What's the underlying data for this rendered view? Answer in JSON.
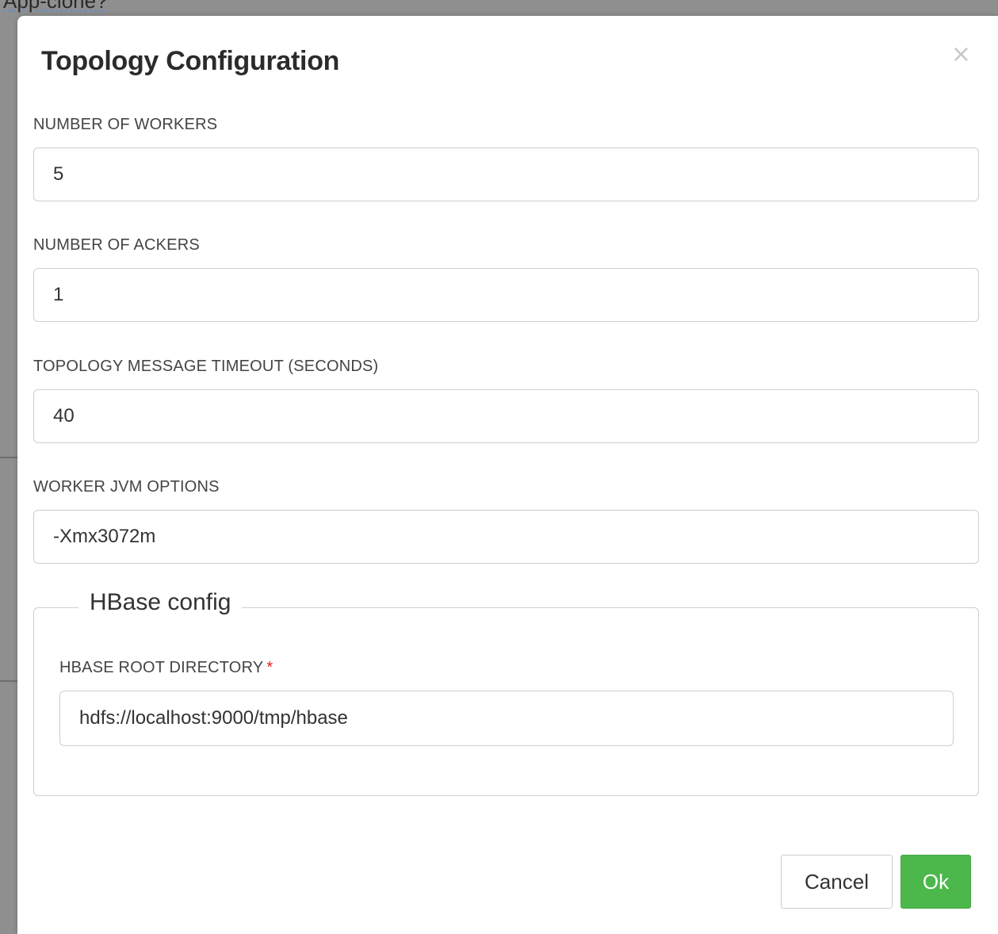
{
  "backdrop": {
    "partial_text": "App-clone?"
  },
  "modal": {
    "title": "Topology Configuration",
    "close_symbol": "×"
  },
  "fields": {
    "workers": {
      "label": "NUMBER OF WORKERS",
      "value": "5"
    },
    "ackers": {
      "label": "NUMBER OF ACKERS",
      "value": "1"
    },
    "timeout": {
      "label": "TOPOLOGY MESSAGE TIMEOUT (SECONDS)",
      "value": "40"
    },
    "jvm": {
      "label": "WORKER JVM OPTIONS",
      "value": "-Xmx3072m"
    }
  },
  "hbase": {
    "legend": "HBase config",
    "root_dir": {
      "label": "HBASE ROOT DIRECTORY",
      "required_marker": "*",
      "value": "hdfs://localhost:9000/tmp/hbase"
    }
  },
  "footer": {
    "cancel_label": "Cancel",
    "ok_label": "Ok"
  },
  "colors": {
    "ok_button": "#4cb84c",
    "required": "#e02020"
  }
}
